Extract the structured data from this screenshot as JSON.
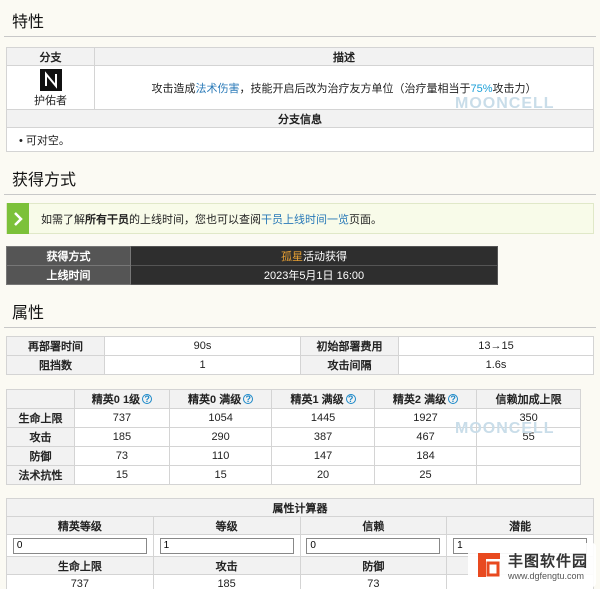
{
  "sections": {
    "traits": "特性",
    "obtain": "获得方式",
    "attributes": "属性"
  },
  "traits_table": {
    "col_branch": "分支",
    "col_desc": "描述",
    "branch_name": "护佑者",
    "desc_prefix": "攻击造成",
    "desc_link": "法术伤害",
    "desc_mid": "，技能开启后改为治疗友方单位（治疗量相当于",
    "desc_pct": "75%",
    "desc_suffix": "攻击力）",
    "info_header": "分支信息",
    "info_item": "可对空。"
  },
  "notice": {
    "prefix": "如需了解",
    "bold": "所有干员",
    "mid": "的上线时间，您也可以查阅",
    "link": "干员上线时间一览",
    "suffix": "页面。"
  },
  "obtain_table": {
    "label_method": "获得方式",
    "method_highlight": "孤星",
    "method_rest": "活动获得",
    "label_time": "上线时间",
    "time_value": "2023年5月1日 16:00"
  },
  "deploy_table": {
    "redeploy_label": "再部署时间",
    "redeploy_value": "90s",
    "cost_label": "初始部署费用",
    "cost_value": "13→15",
    "block_label": "阻挡数",
    "block_value": "1",
    "interval_label": "攻击间隔",
    "interval_value": "1.6s"
  },
  "stats_table": {
    "headers": [
      "精英0 1级",
      "精英0 满级",
      "精英1 满级",
      "精英2 满级",
      "信赖加成上限"
    ],
    "hint": "?",
    "rows": [
      {
        "label": "生命上限",
        "values": [
          "737",
          "1054",
          "1445",
          "1927",
          "350"
        ]
      },
      {
        "label": "攻击",
        "values": [
          "185",
          "290",
          "387",
          "467",
          "55"
        ]
      },
      {
        "label": "防御",
        "values": [
          "73",
          "110",
          "147",
          "184",
          ""
        ]
      },
      {
        "label": "法术抗性",
        "values": [
          "15",
          "15",
          "20",
          "25",
          ""
        ]
      }
    ]
  },
  "calc": {
    "title": "属性计算器",
    "labels": [
      "精英等级",
      "等级",
      "信赖",
      "潜能"
    ],
    "inputs": [
      "0",
      "1",
      "0",
      "1"
    ],
    "out_labels": [
      "生命上限",
      "攻击",
      "防御"
    ],
    "out_values": [
      "737",
      "185",
      "73"
    ]
  },
  "watermark": "MOONCELL",
  "brand": {
    "name": "丰图软件园",
    "url": "www.dgfengtu.com",
    "color": "#e8491f"
  },
  "colors": {
    "highlight": "#d87a00",
    "link": "#2a7ab8",
    "notice_green": "#7cc13a"
  }
}
